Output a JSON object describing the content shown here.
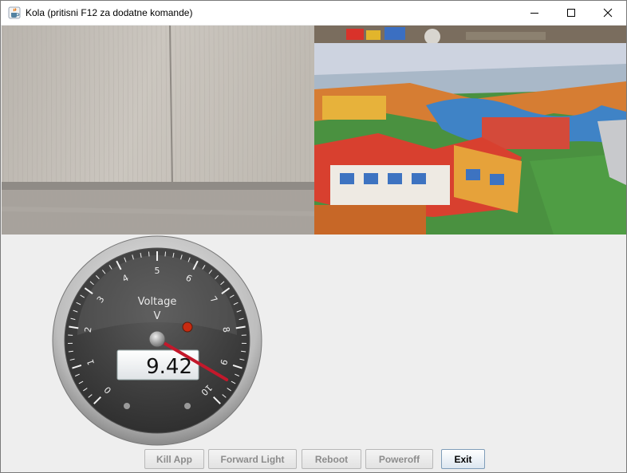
{
  "window": {
    "title": "Kola (pritisni F12 za dodatne komande)",
    "icon": "java-cup-icon"
  },
  "controls": {
    "minimize_icon": "minimize-icon",
    "maximize_icon": "maximize-icon",
    "close_icon": "close-icon"
  },
  "camera_feeds": [
    {
      "name": "left-camera",
      "scene": "wooden cabinet doors"
    },
    {
      "name": "right-camera",
      "scene": "colorful play carpet"
    }
  ],
  "gauge": {
    "title": "Voltage",
    "unit": "V",
    "value": "9.42",
    "needle_value": 9.42,
    "min": 0,
    "max": 10,
    "ticks": [
      "0",
      "1",
      "2",
      "3",
      "4",
      "5",
      "6",
      "7",
      "8",
      "9",
      "10"
    ],
    "colors": {
      "needle": "#c4182b",
      "led": "#c82a10",
      "face": "#3a3a3a"
    }
  },
  "buttons": [
    {
      "label": "Kill App",
      "enabled": false
    },
    {
      "label": "Forward Light",
      "enabled": false
    },
    {
      "label": "Reboot",
      "enabled": false
    },
    {
      "label": "Poweroff",
      "enabled": false
    },
    {
      "label": "Exit",
      "enabled": true
    }
  ]
}
